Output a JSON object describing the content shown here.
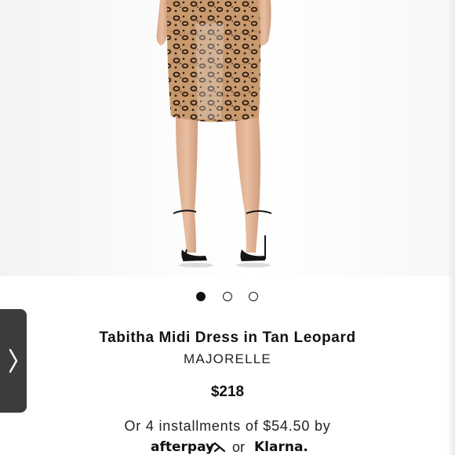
{
  "product": {
    "title": "Tabitha Midi Dress in Tan Leopard",
    "brand": "MAJORELLE",
    "price": "$218"
  },
  "carousel": {
    "slide_count": 3,
    "active_index": 0
  },
  "payment": {
    "installments_text": "Or 4 installments of $54.50 by",
    "afterpay_label": "afterpay",
    "afterpay_icon": "afterpay-arrows-icon",
    "or_label": "or",
    "klarna_label": "Klarna."
  },
  "side_tab": {
    "icon": "chevron-right-icon"
  },
  "colors": {
    "text": "#111111",
    "side_tab_bg": "#3c3c3c",
    "leopard_base": "#c99a6e",
    "leopard_spot": "#2a1a10"
  }
}
